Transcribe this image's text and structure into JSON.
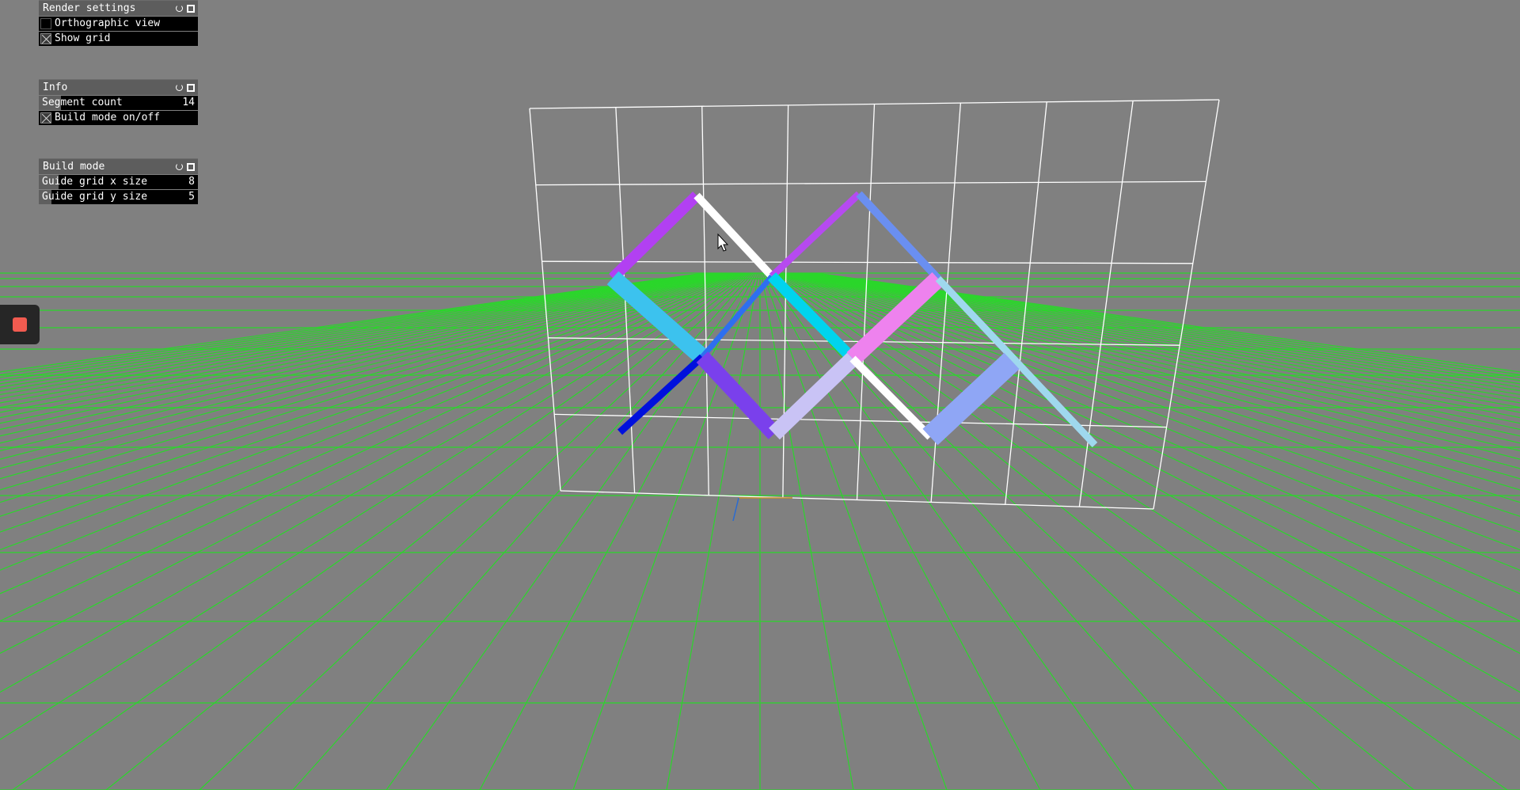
{
  "panels": {
    "render": {
      "title": "Render settings",
      "orthographic": {
        "label": "Orthographic view",
        "checked": false
      },
      "show_grid": {
        "label": "Show grid",
        "checked": true
      }
    },
    "info": {
      "title": "Info",
      "segment_count": {
        "label": "Segment count",
        "value": "14"
      },
      "build_mode": {
        "label": "Build mode on/off",
        "checked": true
      }
    },
    "build": {
      "title": "Build mode",
      "guide_x": {
        "label": "Guide grid x size",
        "value": "8",
        "level": 0.125
      },
      "guide_y": {
        "label": "Guide grid y size",
        "value": "5",
        "level": 0.08
      }
    }
  },
  "icons": {
    "refresh": "refresh-icon",
    "minimize": "minimize-icon",
    "stop": "stop-icon",
    "cursor": "mouse-cursor-icon"
  },
  "colors": {
    "background": "#808080",
    "floor_grid": "#2bd62b",
    "guide_grid": "#ffffff",
    "stop_button": "#f15b50",
    "segments": [
      "#b240f2",
      "#ffffff",
      "#b64af0",
      "#6a8ff1",
      "#3cc2ee",
      "#2e6ff0",
      "#00d4ee",
      "#ee82ee",
      "#9fd8ee",
      "#0010dd",
      "#7a40ec",
      "#c9c3f5",
      "#ffffff",
      "#8fa6f5"
    ]
  }
}
